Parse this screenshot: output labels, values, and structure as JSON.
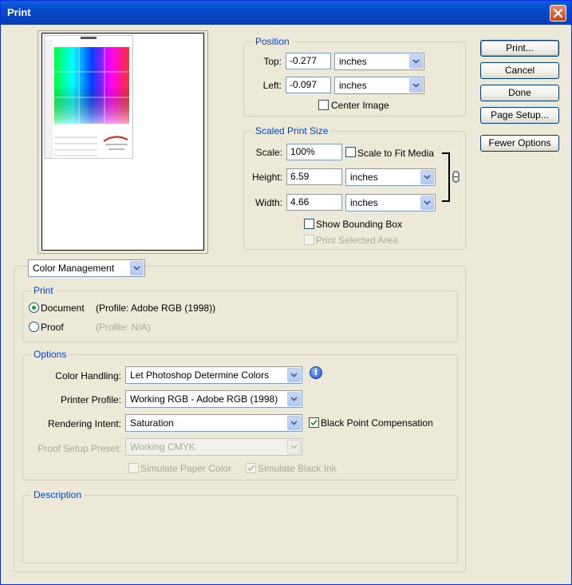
{
  "window": {
    "title": "Print"
  },
  "buttons": {
    "print": "Print...",
    "cancel": "Cancel",
    "done": "Done",
    "page_setup": "Page Setup...",
    "fewer_options": "Fewer Options"
  },
  "position": {
    "legend": "Position",
    "top_label": "Top:",
    "top_value": "-0.277",
    "top_unit": "inches",
    "left_label": "Left:",
    "left_value": "-0.097",
    "left_unit": "inches",
    "center_image": "Center Image",
    "center_image_checked": false
  },
  "scaled": {
    "legend": "Scaled Print Size",
    "scale_label": "Scale:",
    "scale_value": "100%",
    "scale_to_fit": "Scale to Fit Media",
    "height_label": "Height:",
    "height_value": "6.59",
    "height_unit": "inches",
    "width_label": "Width:",
    "width_value": "4.66",
    "width_unit": "inches",
    "show_bounding_box": "Show Bounding Box",
    "print_selected_area": "Print Selected Area"
  },
  "section_select": "Color Management",
  "print_group": {
    "legend": "Print",
    "document_label": "Document",
    "document_profile": "(Profile: Adobe RGB (1998))",
    "proof_label": "Proof",
    "proof_profile": "(Profile: N/A)",
    "selected": "document"
  },
  "options": {
    "legend": "Options",
    "color_handling_label": "Color Handling:",
    "color_handling_value": "Let Photoshop Determine Colors",
    "printer_profile_label": "Printer Profile:",
    "printer_profile_value": "Working RGB - Adobe RGB (1998)",
    "rendering_intent_label": "Rendering Intent:",
    "rendering_intent_value": "Saturation",
    "black_point": "Black Point Compensation",
    "black_point_checked": true,
    "proof_setup_label": "Proof Setup Preset:",
    "proof_setup_value": "Working CMYK",
    "simulate_paper": "Simulate Paper Color",
    "simulate_ink": "Simulate Black Ink",
    "simulate_ink_checked": true
  },
  "description": {
    "legend": "Description"
  },
  "colors": {
    "accent": "#0046d5",
    "title_bar": "#0848c8",
    "face": "#ece9d8"
  }
}
